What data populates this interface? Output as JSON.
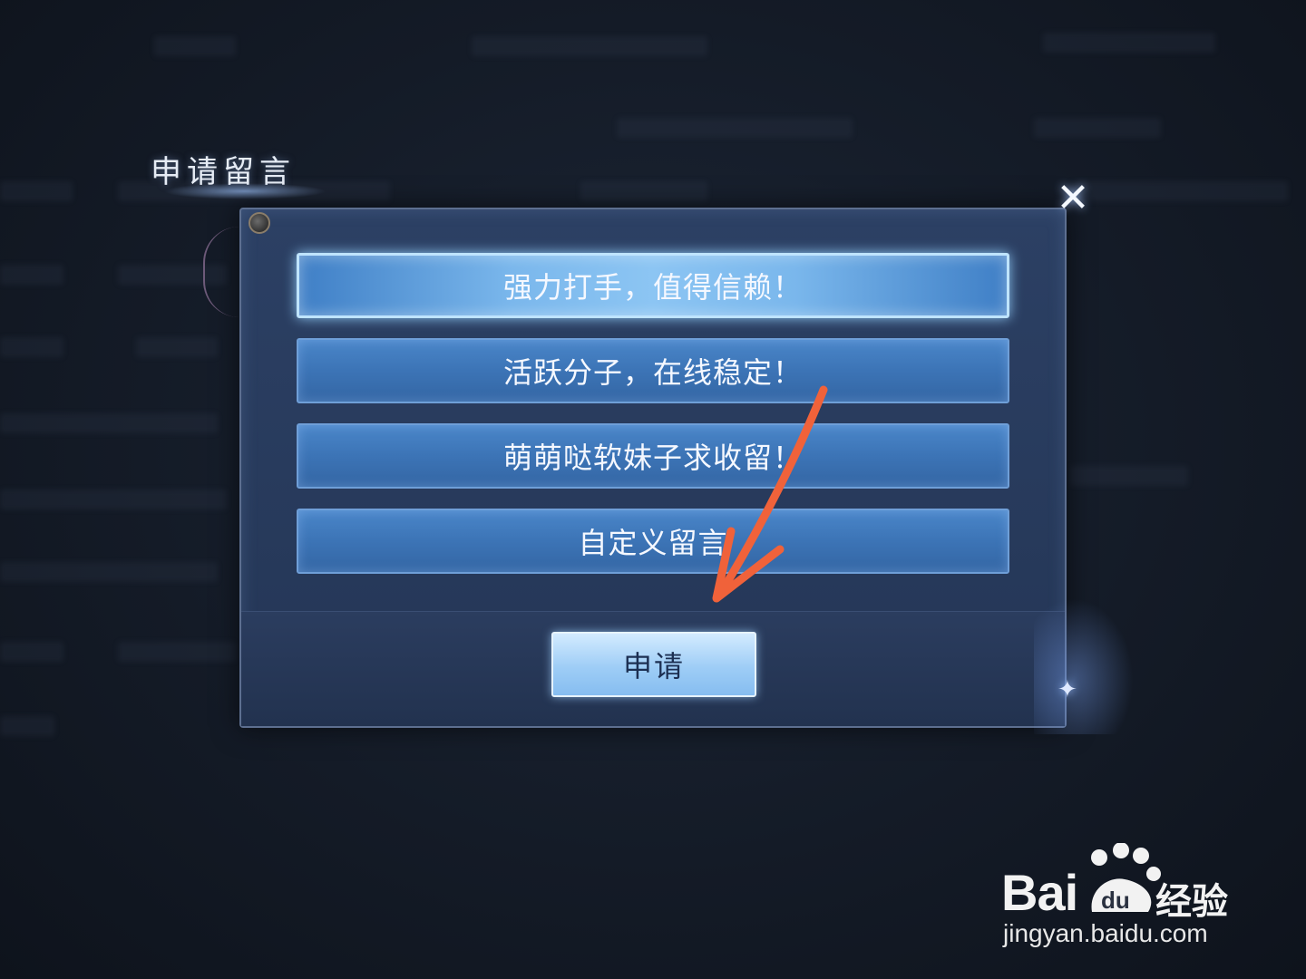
{
  "dialog": {
    "title": "申请留言",
    "close_symbol": "✕",
    "options": [
      {
        "label": "强力打手，值得信赖！",
        "selected": true
      },
      {
        "label": "活跃分子，在线稳定！",
        "selected": false
      },
      {
        "label": "萌萌哒软妹子求收留！",
        "selected": false
      },
      {
        "label": "自定义留言",
        "selected": false
      }
    ],
    "apply_label": "申请"
  },
  "annotation": {
    "arrow_color": "#f0623a"
  },
  "watermark": {
    "brand": "Bai",
    "paw_text": "du",
    "product": "经验",
    "url": "jingyan.baidu.com"
  },
  "icons": {
    "close": "close-icon",
    "sparkle": "sparkle-icon",
    "pin": "pin-icon"
  }
}
